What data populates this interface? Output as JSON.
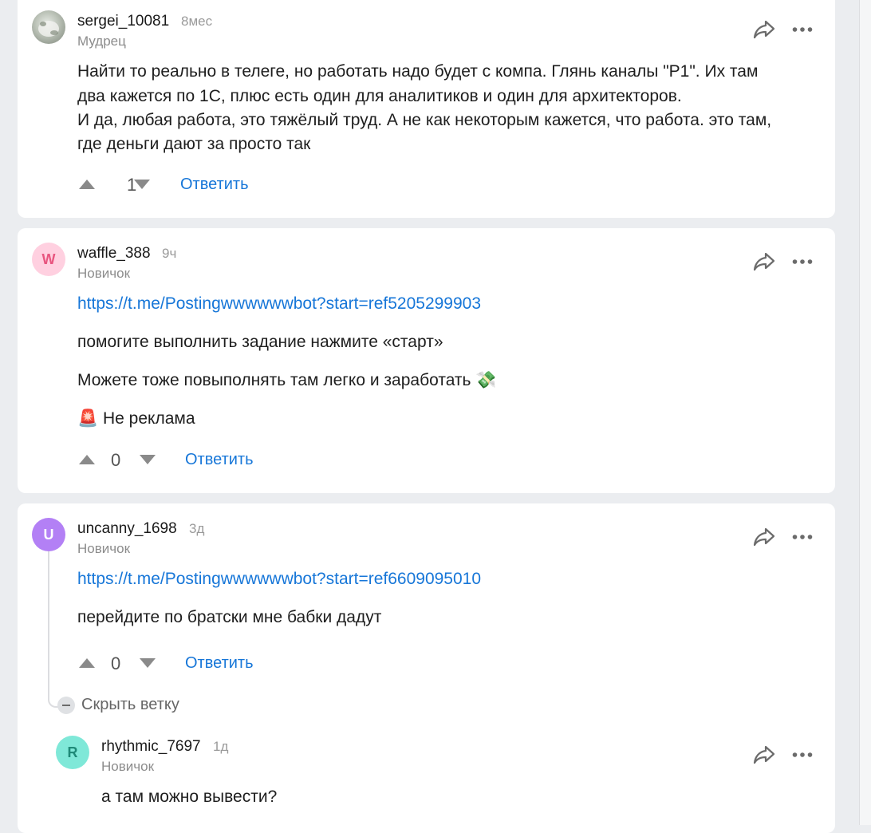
{
  "comments": [
    {
      "username": "sergei_10081",
      "time": "8мес",
      "rank": "Мудрец",
      "lines": [
        "Найти то реально в телеге, но работать надо будет с компа. Глянь каналы \"P1\". Их там",
        "два кажется по 1С, плюс есть один для аналитиков и один для архитекторов.",
        "И да, любая работа, это тяжёлый труд. А не как некоторым кажется, что работа. это там,",
        "где деньги дают за просто так"
      ],
      "score": "1",
      "reply_label": "Ответить"
    },
    {
      "username": "waffle_388",
      "time": "9ч",
      "rank": "Новичок",
      "avatar_letter": "W",
      "link": "https://t.me/Postingwwwwwwbot?start=ref5205299903",
      "paragraphs": [
        "помогите выполнить задание нажмите «старт»",
        "Можете тоже повыполнять там легко  и заработать 💸",
        "🚨 Не реклама"
      ],
      "score": "0",
      "reply_label": "Ответить"
    },
    {
      "username": "uncanny_1698",
      "time": "3д",
      "rank": "Новичок",
      "avatar_letter": "U",
      "link": "https://t.me/Postingwwwwwwbot?start=ref6609095010",
      "paragraphs": [
        "перейдите по братски мне бабки дадут"
      ],
      "score": "0",
      "reply_label": "Ответить",
      "hide_thread_label": "Скрыть ветку"
    },
    {
      "username": "rhythmic_7697",
      "time": "1д",
      "rank": "Новичок",
      "avatar_letter": "R",
      "paragraphs": [
        "а там можно вывести?"
      ]
    }
  ],
  "colors": {
    "link": "#1676d8",
    "avatar_w": "#ffd0e0",
    "avatar_u": "#b380f5",
    "avatar_r": "#7fe8d8"
  }
}
